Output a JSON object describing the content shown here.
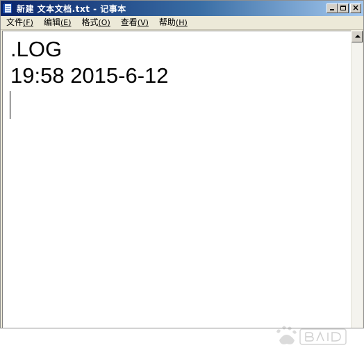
{
  "window": {
    "title": "新建 文本文档.txt - 记事本"
  },
  "menu": {
    "items": [
      {
        "label": "文件",
        "accel": "(F)"
      },
      {
        "label": "编辑",
        "accel": "(E)"
      },
      {
        "label": "格式",
        "accel": "(O)"
      },
      {
        "label": "查看",
        "accel": "(V)"
      },
      {
        "label": "帮助",
        "accel": "(H)"
      }
    ]
  },
  "editor": {
    "lines": [
      ".LOG",
      "19:58 2015-6-12"
    ]
  },
  "icons": {
    "app": "notepad-icon",
    "minimize": "minimize-icon",
    "maximize": "maximize-icon",
    "close": "close-icon",
    "scroll_up": "scroll-up-arrow-icon",
    "watermark": "baidu-watermark"
  }
}
